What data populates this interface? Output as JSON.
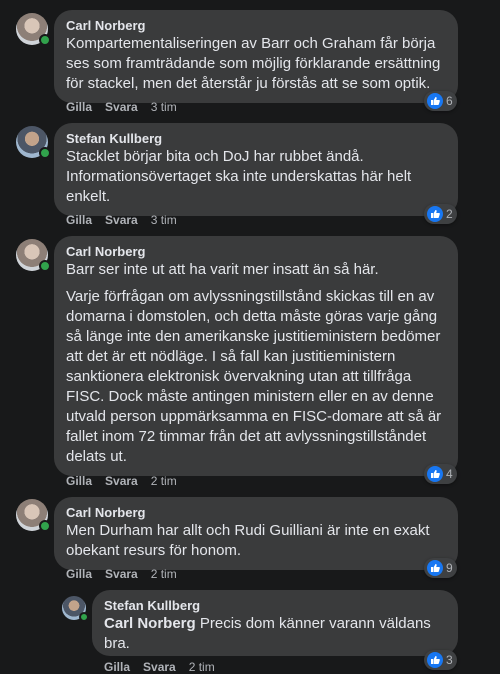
{
  "comments": [
    {
      "author": "Carl Norberg",
      "paragraphs": [
        "Kompartementaliseringen av Barr och Graham får börja ses som framträdande som möjlig förklarande ersättning för stackel, men det återstår ju förstås att se som optik."
      ],
      "like_label": "Gilla",
      "reply_label": "Svara",
      "time": "3 tim",
      "reactions": "6"
    },
    {
      "author": "Stefan Kullberg",
      "paragraphs": [
        "Stacklet börjar bita och DoJ har rubbet ändå. Informationsövertaget ska inte underskattas här helt enkelt."
      ],
      "like_label": "Gilla",
      "reply_label": "Svara",
      "time": "3 tim",
      "reactions": "2"
    },
    {
      "author": "Carl Norberg",
      "paragraphs": [
        "Barr ser inte ut att ha varit mer insatt än så här.",
        "Varje förfrågan om avlyssningstillstånd skickas till en av domarna i domstolen, och detta måste göras varje gång så länge inte den amerikanske justitieministern bedömer att det är ett nödläge. I så fall kan justitieministern sanktionera elektronisk övervakning utan att tillfråga FISC. Dock måste antingen ministern eller en av denne utvald person uppmärksamma en FISC-domare att så är fallet inom 72 timmar från det att avlyssningstillståndet delats ut."
      ],
      "like_label": "Gilla",
      "reply_label": "Svara",
      "time": "2 tim",
      "reactions": "4"
    },
    {
      "author": "Carl Norberg",
      "paragraphs": [
        "Men Durham har allt och Rudi Guilliani är inte en exakt obekant resurs för honom."
      ],
      "like_label": "Gilla",
      "reply_label": "Svara",
      "time": "2 tim",
      "reactions": "9"
    }
  ],
  "reply": {
    "author": "Stefan Kullberg",
    "mention": "Carl Norberg",
    "text": " Precis dom känner varann väldans bra.",
    "like_label": "Gilla",
    "reply_label": "Svara",
    "time": "2 tim",
    "reactions": "3"
  },
  "colors": {
    "background": "#18191a",
    "bubble": "#3a3b3c",
    "like_blue": "#1877f2",
    "online_green": "#31a24c"
  }
}
